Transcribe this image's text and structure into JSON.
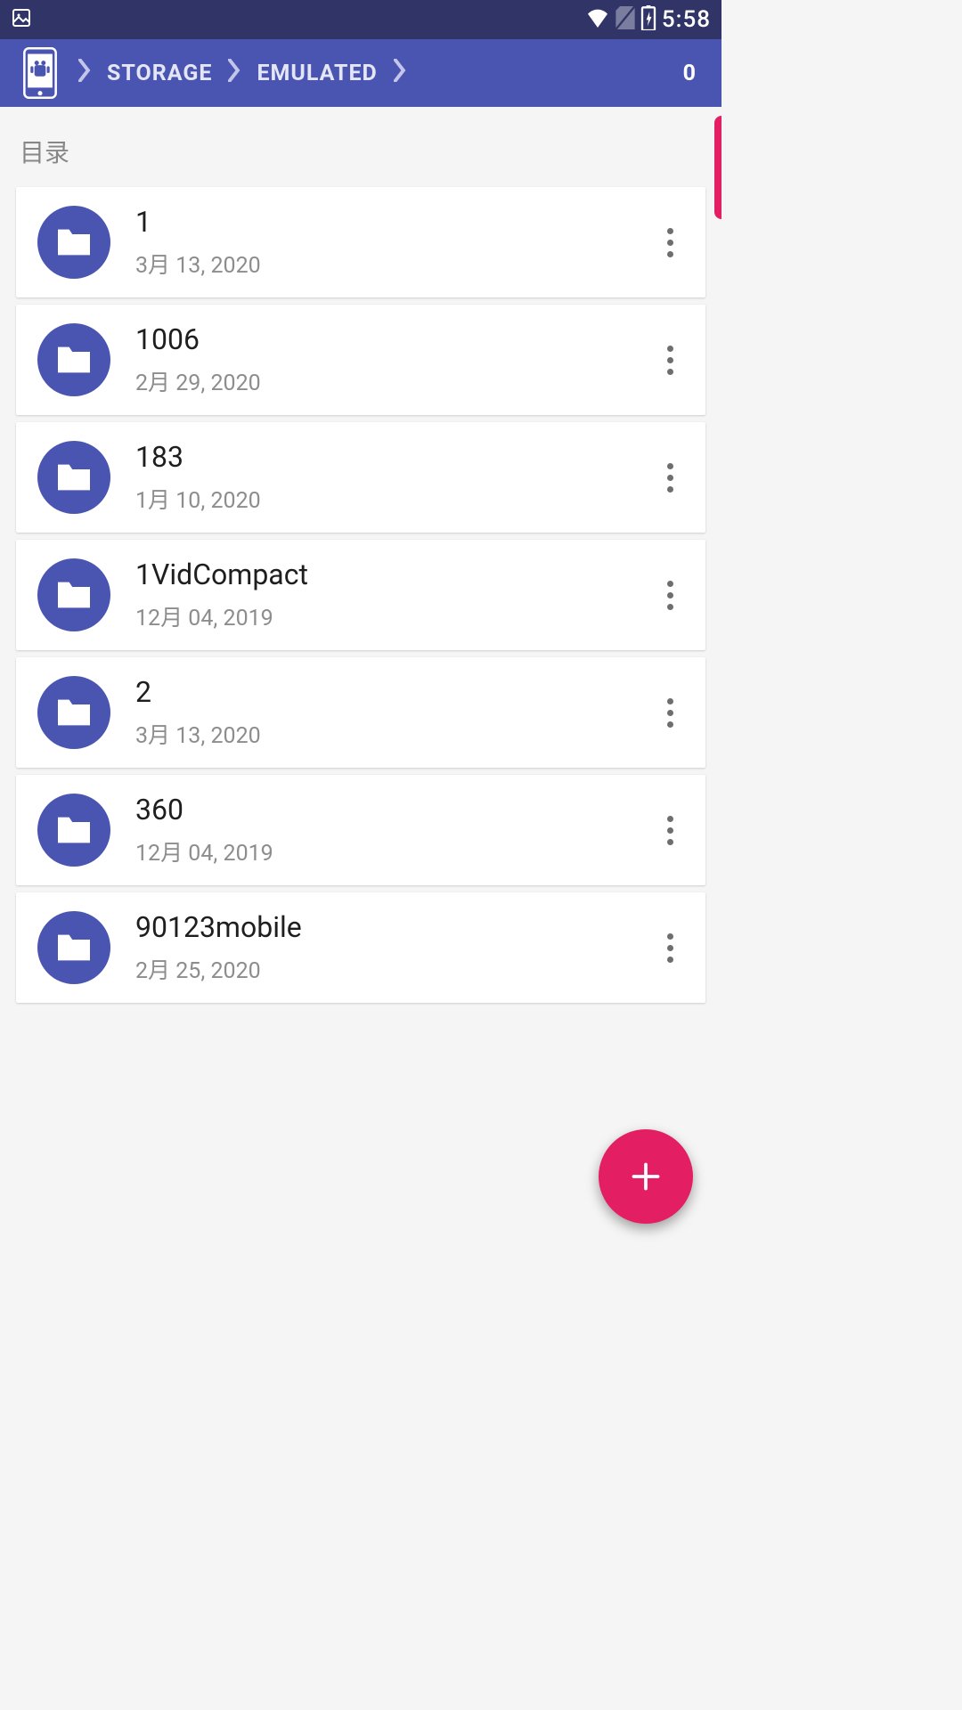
{
  "status": {
    "time": "5:58"
  },
  "breadcrumb": {
    "items": [
      "STORAGE",
      "EMULATED",
      "0"
    ]
  },
  "section": {
    "label": "目录"
  },
  "folders": [
    {
      "name": "1",
      "date": "3月 13, 2020"
    },
    {
      "name": "1006",
      "date": "2月 29, 2020"
    },
    {
      "name": "183",
      "date": "1月 10, 2020"
    },
    {
      "name": "1VidCompact",
      "date": "12月 04, 2019"
    },
    {
      "name": "2",
      "date": "3月 13, 2020"
    },
    {
      "name": "360",
      "date": "12月 04, 2019"
    },
    {
      "name": "90123mobile",
      "date": "2月 25, 2020"
    }
  ]
}
